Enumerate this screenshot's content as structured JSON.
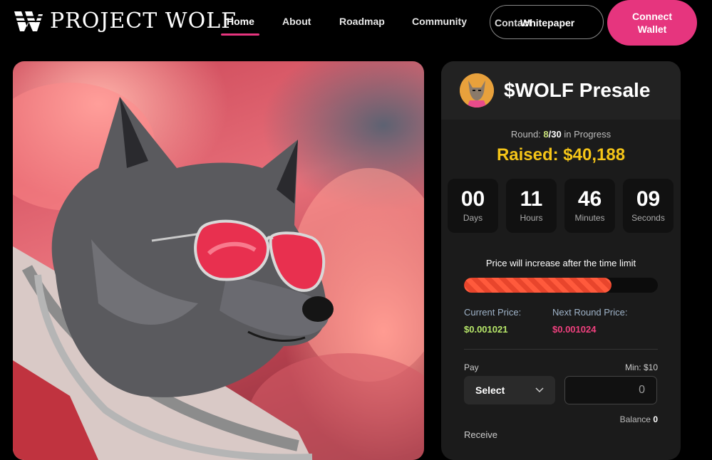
{
  "header": {
    "logo_text": "PROJECT WOLF",
    "nav": [
      {
        "label": "Home",
        "active": true
      },
      {
        "label": "About"
      },
      {
        "label": "Roadmap"
      },
      {
        "label": "Community"
      }
    ],
    "contact_label": "Contact",
    "whitepaper_label": "Whitepaper",
    "connect_label": "Connect\nWallet",
    "accent_color": "#e6357e"
  },
  "hero": {
    "image_desc": "wolf-astronaut-sunglasses"
  },
  "presale": {
    "title": "$WOLF Presale",
    "round_prefix": "Round: ",
    "round_current": "8",
    "round_total": "/30",
    "round_suffix": " in Progress",
    "raised": "Raised: $40,188",
    "timer": [
      {
        "value": "00",
        "label": "Days"
      },
      {
        "value": "11",
        "label": "Hours"
      },
      {
        "value": "46",
        "label": "Minutes"
      },
      {
        "value": "09",
        "label": "Seconds"
      }
    ],
    "limit_text": "Price will increase after the time limit",
    "progress_fraction": 0.76,
    "current_price_label": "Current Price:",
    "current_price": "$0.001021",
    "next_price_label": "Next Round Price:",
    "next_price": "$0.001024",
    "pay_label": "Pay",
    "min_label": "Min: $10",
    "select_label": "Select",
    "amount_placeholder": "0",
    "balance_label": "Balance ",
    "balance_value": "0",
    "receive_label": "Receive",
    "colors": {
      "raised": "#f5c518",
      "current_price": "#b8e86a",
      "next_price": "#f0407e"
    }
  }
}
